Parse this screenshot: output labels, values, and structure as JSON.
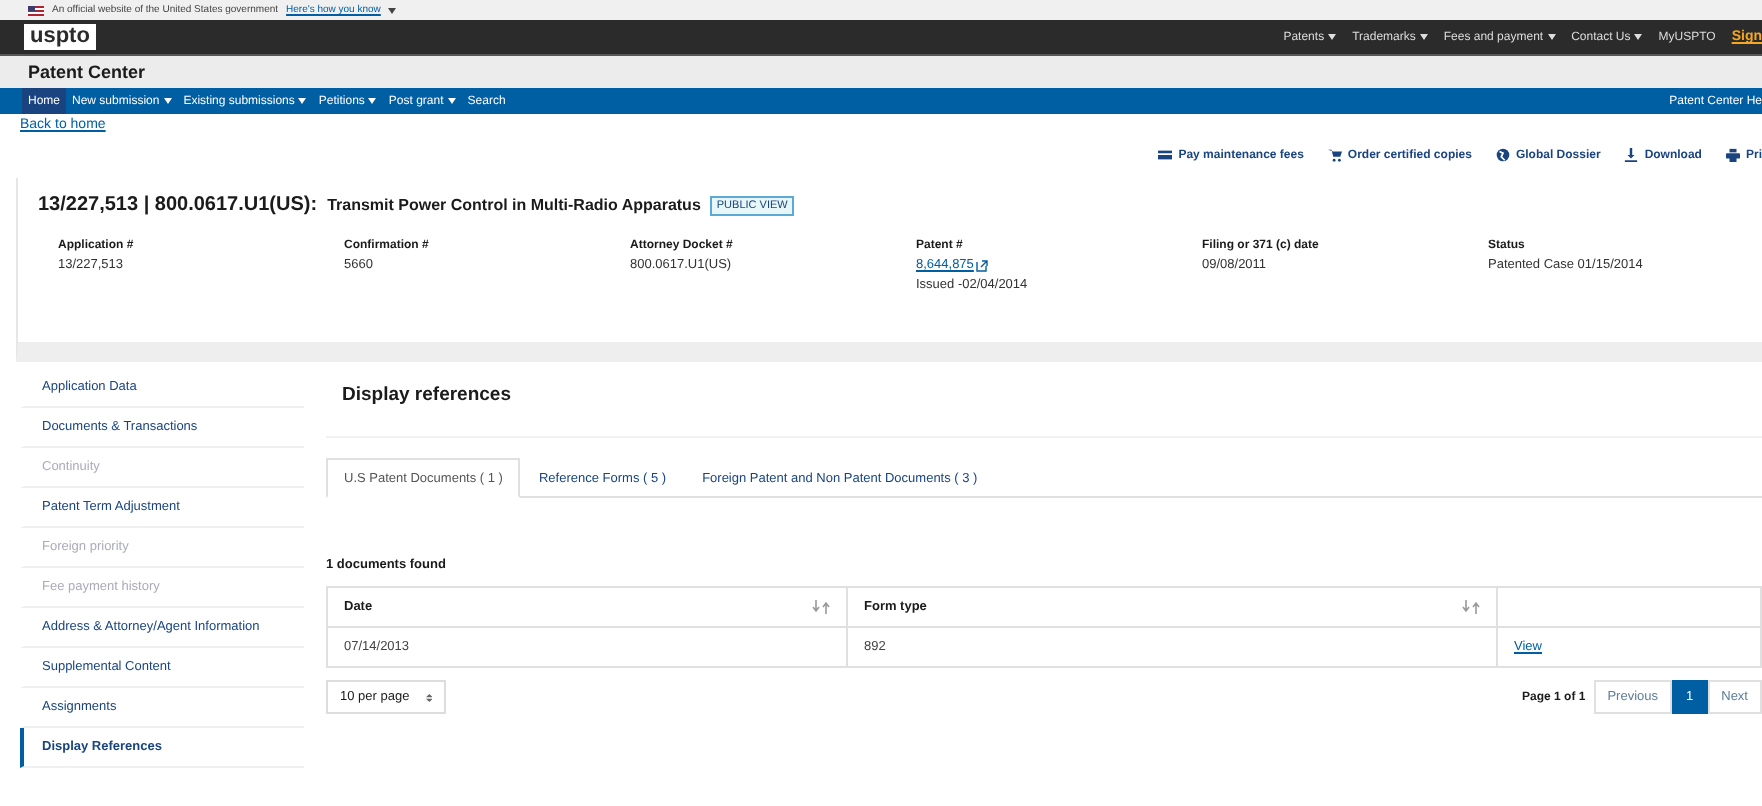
{
  "gov_banner": {
    "text": "An official website of the United States government",
    "link": "Here's how you know"
  },
  "header": {
    "logo": "uspto",
    "links": [
      {
        "label": "Patents",
        "dropdown": true
      },
      {
        "label": "Trademarks",
        "dropdown": true
      },
      {
        "label": "Fees and payment",
        "dropdown": true
      },
      {
        "label": "Contact Us",
        "dropdown": true
      },
      {
        "label": "MyUSPTO",
        "dropdown": false
      }
    ],
    "sign_in": "Sign"
  },
  "app_title": "Patent Center",
  "nav": {
    "items": [
      {
        "label": "Home",
        "selected": true,
        "dropdown": false
      },
      {
        "label": "New submission",
        "selected": false,
        "dropdown": true
      },
      {
        "label": "Existing submissions",
        "selected": false,
        "dropdown": true
      },
      {
        "label": "Petitions",
        "selected": false,
        "dropdown": true
      },
      {
        "label": "Post grant",
        "selected": false,
        "dropdown": true
      },
      {
        "label": "Search",
        "selected": false,
        "dropdown": false
      }
    ],
    "help": "Patent Center He"
  },
  "back_link": "Back to home",
  "actions": [
    {
      "label": "Pay maintenance fees",
      "kind": "card"
    },
    {
      "label": "Order certified copies",
      "kind": "cart"
    },
    {
      "label": "Global Dossier",
      "kind": "globe"
    },
    {
      "label": "Download",
      "kind": "download"
    },
    {
      "label": "Pri",
      "kind": "print"
    }
  ],
  "application": {
    "title": "13/227,513 | 800.0617.U1(US):",
    "subtitle": "Transmit Power Control in Multi-Radio Apparatus",
    "badge": "PUBLIC VIEW",
    "fields": [
      {
        "label": "Application #",
        "value": "13/227,513"
      },
      {
        "label": "Confirmation #",
        "value": "5660"
      },
      {
        "label": "Attorney Docket #",
        "value": "800.0617.U1(US)"
      },
      {
        "label": "Patent #",
        "link": "8,644,875",
        "note": "Issued -02/04/2014"
      },
      {
        "label": "Filing or 371 (c) date",
        "value": "09/08/2011"
      },
      {
        "label": "Status",
        "value": "Patented Case 01/15/2014"
      }
    ]
  },
  "sidebar": {
    "items": [
      {
        "label": "Application Data",
        "selected": false,
        "disabled": false
      },
      {
        "label": "Documents & Transactions",
        "selected": false,
        "disabled": false
      },
      {
        "label": "Continuity",
        "selected": false,
        "disabled": true
      },
      {
        "label": "Patent Term Adjustment",
        "selected": false,
        "disabled": false
      },
      {
        "label": "Foreign priority",
        "selected": false,
        "disabled": true
      },
      {
        "label": "Fee payment history",
        "selected": false,
        "disabled": true
      },
      {
        "label": "Address & Attorney/Agent Information",
        "selected": false,
        "disabled": false
      },
      {
        "label": "Supplemental Content",
        "selected": false,
        "disabled": false
      },
      {
        "label": "Assignments",
        "selected": false,
        "disabled": false
      },
      {
        "label": "Display References",
        "selected": true,
        "disabled": false
      }
    ]
  },
  "references": {
    "heading": "Display references",
    "tabs": [
      {
        "label": "U.S Patent Documents ( 1 )",
        "selected": true
      },
      {
        "label": "Reference Forms ( 5 )",
        "selected": false
      },
      {
        "label": "Foreign Patent and Non Patent Documents ( 3 )",
        "selected": false
      }
    ],
    "count": "1 documents found",
    "table": {
      "columns": [
        {
          "label": "Date",
          "sortable": true
        },
        {
          "label": "Form type",
          "sortable": true
        },
        {
          "sortable": false
        }
      ],
      "rows": [
        {
          "cells": [
            "07/14/2013",
            "892"
          ],
          "link": "View"
        }
      ]
    },
    "per_page": "10 per page",
    "pagination": {
      "summary": "Page 1 of 1",
      "previous": "Previous",
      "pages": [
        {
          "label": "1",
          "selected": true
        }
      ],
      "next": "Next"
    }
  }
}
